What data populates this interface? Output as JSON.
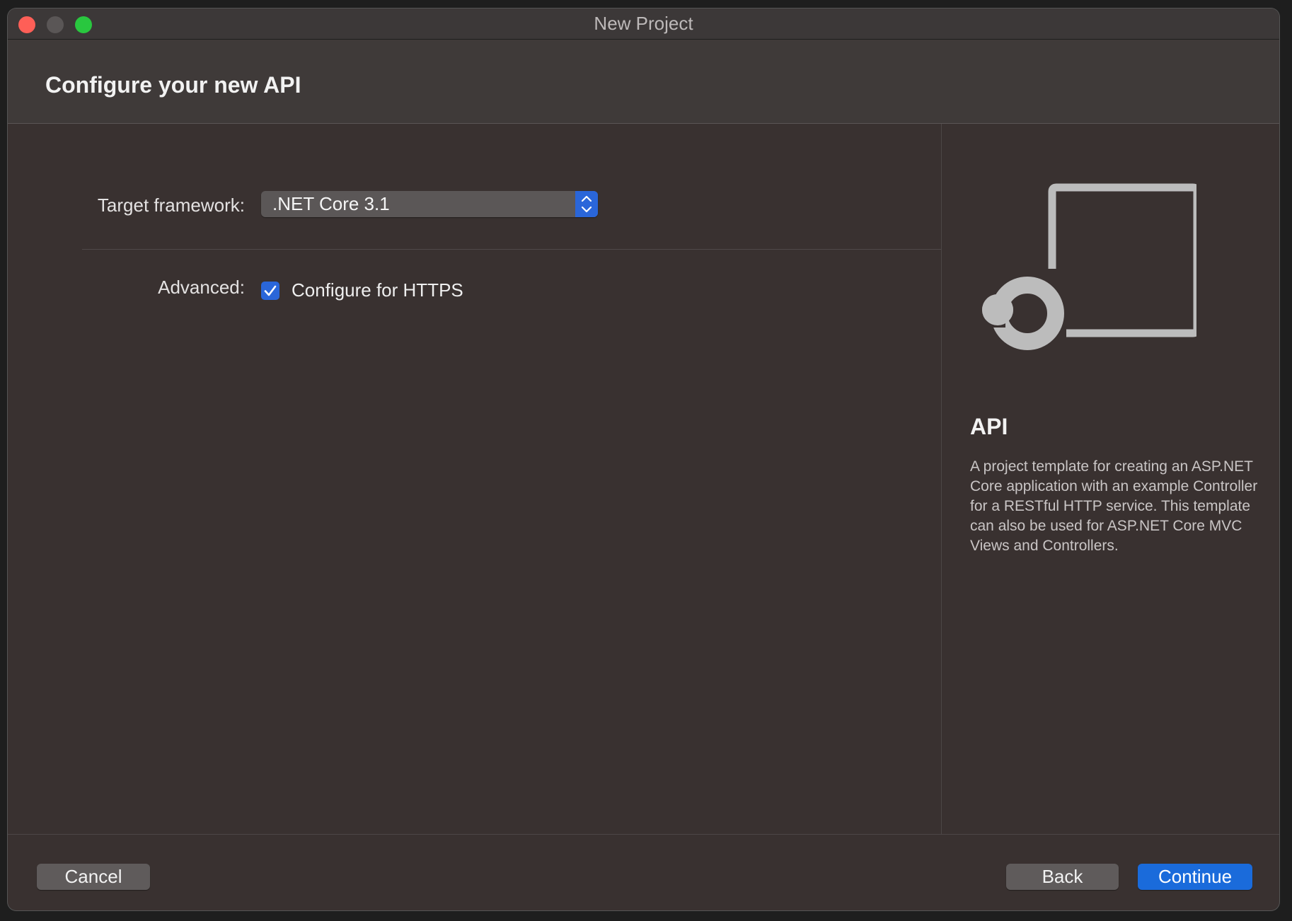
{
  "window": {
    "title": "New Project"
  },
  "header": {
    "title": "Configure your new API"
  },
  "form": {
    "framework_label": "Target framework:",
    "framework_value": ".NET Core 3.1",
    "advanced_label": "Advanced:",
    "https_label": "Configure for HTTPS",
    "https_checked": true
  },
  "side": {
    "illustration_icon": "api-template-icon",
    "title": "API",
    "description": "A project template for creating an ASP.NET Core application with an example Controller for a RESTful HTTP service. This template can also be used for ASP.NET Core MVC Views and Controllers."
  },
  "footer": {
    "cancel_label": "Cancel",
    "back_label": "Back",
    "continue_label": "Continue"
  },
  "colors": {
    "accent": "#2a66d9",
    "close": "#fe5f57",
    "maximize": "#29c73f"
  }
}
